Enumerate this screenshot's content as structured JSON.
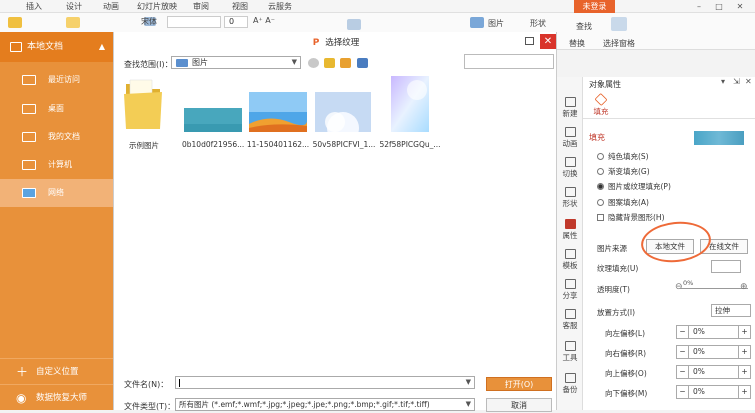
{
  "menubar": {
    "items": [
      "插入",
      "设计",
      "动画",
      "幻灯片放映",
      "审阅",
      "视图",
      "云服务"
    ],
    "login": "未登录"
  },
  "ribbon": {
    "font_name": "宋体",
    "font_size": "0",
    "image_label": "图片",
    "shape_label": "形状",
    "select_label": "替换",
    "select_pane": "选择窗格",
    "find_label": "查找"
  },
  "left_panel": {
    "title": "本地文档",
    "items": [
      {
        "label": "最近访问"
      },
      {
        "label": "桌面"
      },
      {
        "label": "我的文档"
      },
      {
        "label": "计算机"
      },
      {
        "label": "网络"
      }
    ],
    "bottom": [
      {
        "label": "自定义位置"
      },
      {
        "label": "数据恢复大师"
      }
    ]
  },
  "dialog": {
    "title": "选择纹理",
    "look_in_label": "查找范围(I)：",
    "look_in_value": "图片",
    "files": [
      {
        "name": "示例图片"
      },
      {
        "name": "0b10d0f21956..."
      },
      {
        "name": "11-150401162..."
      },
      {
        "name": "50v58PICFVI_1..."
      },
      {
        "name": "52f58PICGQu_..."
      }
    ],
    "filename_label": "文件名(N)：",
    "filename_value": "",
    "filetype_label": "文件类型(T)：",
    "filetype_value": "所有图片 (*.emf;*.wmf;*.jpg;*.jpeg;*.jpe;*.png;*.bmp;*.gif;*.tif;*.tiff)",
    "open_button": "打开(O)",
    "cancel_button": "取消"
  },
  "vtabs": [
    "新建",
    "动画",
    "切换",
    "形状",
    "属性",
    "模板",
    "分享",
    "客服",
    "工具",
    "备份"
  ],
  "properties": {
    "title": "对象属性",
    "tab_fill": "填充",
    "section_fill": "填充",
    "radios": [
      {
        "label": "纯色填充(S)",
        "checked": false
      },
      {
        "label": "渐变填充(G)",
        "checked": false
      },
      {
        "label": "图片或纹理填充(P)",
        "checked": true
      },
      {
        "label": "图案填充(A)",
        "checked": false
      }
    ],
    "hide_bg": "隐藏背景图形(H)",
    "source_label": "图片来源",
    "local_file": "本地文件",
    "online_file": "在线文件",
    "texture_label": "纹理填充(U)",
    "transparency_label": "透明度(T)",
    "transparency_value": "0%",
    "placement_label": "放置方式(I)",
    "placement_value": "拉伸",
    "offsets": [
      {
        "label": "向左偏移(L)",
        "value": "0%"
      },
      {
        "label": "向右偏移(R)",
        "value": "0%"
      },
      {
        "label": "向上偏移(O)",
        "value": "0%"
      },
      {
        "label": "向下偏移(M)",
        "value": "0%"
      }
    ]
  },
  "colors": {
    "accent": "#e8913a",
    "accent_dark": "#e47d1e",
    "close_red": "#d9342b"
  }
}
